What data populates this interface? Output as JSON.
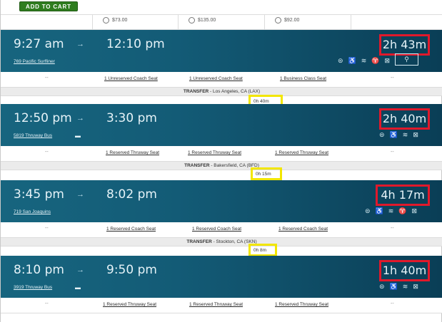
{
  "header": {
    "add_to_cart": "ADD TO CART"
  },
  "prices": [
    "$73.00",
    "$135.00",
    "$92.00"
  ],
  "segments": [
    {
      "depart": "9:27 am",
      "arrive": "12:10 pm",
      "train": "769 Pacific Surfliner",
      "duration": "2h 43m",
      "bus": false,
      "seats": [
        "--",
        "1 Unreserved Coach Seat",
        "1 Unreserved Coach Seat",
        "1 Business Class Seat",
        "--"
      ],
      "transfer": {
        "label": "TRANSFER",
        "place": "Los Angeles, CA (LAX)",
        "wait": "0h 40m"
      }
    },
    {
      "depart": "12:50 pm",
      "arrive": "3:30 pm",
      "train": "5819 Thruway Bus",
      "duration": "2h 40m",
      "bus": true,
      "seats": [
        "--",
        "1 Reserved Thruway Seat",
        "1 Reserved Thruway Seat",
        "1 Reserved Thruway Seat",
        "--"
      ],
      "transfer": {
        "label": "TRANSFER",
        "place": "Bakersfield, CA (BFD)",
        "wait": "0h 15m"
      }
    },
    {
      "depart": "3:45 pm",
      "arrive": "8:02 pm",
      "train": "719 San Joaquins",
      "duration": "4h 17m",
      "bus": false,
      "seats": [
        "--",
        "1 Reserved Coach Seat",
        "1 Reserved Coach Seat",
        "1 Reserved Coach Seat",
        "--"
      ],
      "transfer": {
        "label": "TRANSFER",
        "place": "Stockton, CA (SKN)",
        "wait": "0h 8m"
      }
    },
    {
      "depart": "8:10 pm",
      "arrive": "9:50 pm",
      "train": "3919 Thruway Bus",
      "duration": "1h 40m",
      "bus": true,
      "seats": [
        "--",
        "1 Reserved Thruway Seat",
        "1 Reserved Thruway Seat",
        "1 Reserved Thruway Seat",
        "--"
      ]
    }
  ],
  "colors": {
    "band": "#135b76",
    "highlight_red": "#e0192b",
    "highlight_yellow": "#f2e600",
    "cart_green": "#2f7d1f"
  }
}
